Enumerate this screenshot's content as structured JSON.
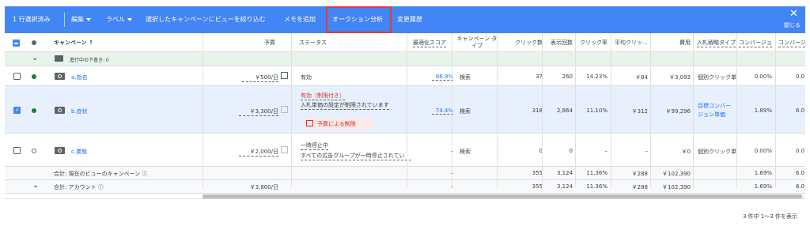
{
  "toolbar": {
    "selected": "1 行選択済み",
    "edit": "編集",
    "label": "ラベル",
    "filter_view": "選択したキャンペーンにビューを絞り込む",
    "add_memo": "メモを追加",
    "auction": "オークション分析",
    "history": "変更履歴",
    "close": "閉じる"
  },
  "colors": {
    "toolbar": "#4285f4",
    "link": "#1a73e8",
    "highlight": "#e53935",
    "selected_row": "#e8f0fe",
    "folder_row": "#e6f4ea",
    "status_red": "#d93025",
    "budget_limited_bg": "#fce8e6"
  },
  "header": {
    "campaign": "キャンペーン",
    "budget": "予算",
    "status": "ステータス",
    "opt_score": "最適化スコア",
    "type": "キャンペーン タイプ",
    "clicks": "クリック数",
    "impressions": "表示回数",
    "ctr": "クリック率",
    "avg_cpc": "平均クリッ…",
    "cost": "費用",
    "bid_strategy": "入札戦略タイプ",
    "conv1": "コンバージョ",
    "conv2": "コンバージョ"
  },
  "folder": {
    "label": "進行中の下書き: 0"
  },
  "rows": [
    {
      "name": "a.指名",
      "budget": "￥500/日",
      "status": "有効",
      "opt": "86.9%",
      "type": "検索",
      "clicks": "37",
      "impr": "260",
      "ctr": "14.23%",
      "cpc": "￥84",
      "cost": "￥3,093",
      "bid": "個別クリック単価",
      "conv1": "0.00%",
      "conv2": "0.0"
    },
    {
      "name": "b.症状",
      "budget": "￥3,300/日",
      "status": "有効（制限付き）",
      "status_sub": "入札単価の設定が制限されています",
      "status_badge": "予算による制限",
      "opt": "74.4%",
      "type": "検索",
      "clicks": "318",
      "impr": "2,864",
      "ctr": "11.10%",
      "cpc": "￥312",
      "cost": "￥99,296",
      "bid": "目標コンバージョン単価",
      "conv1": "1.89%",
      "conv2": "6.0"
    },
    {
      "name": "c.業態",
      "budget": "￥2,000/日",
      "status": "一時停止中",
      "status_sub": "すべての広告グループが一時停止されてい",
      "opt": "–",
      "type": "検索",
      "clicks": "0",
      "impr": "0",
      "ctr": "–",
      "cpc": "–",
      "cost": "￥0",
      "bid": "個別クリック単価",
      "conv1": "0.00%",
      "conv2": "0.0"
    }
  ],
  "totals": [
    {
      "label": "合計: 現在のビューのキャンペーン",
      "opt": "–",
      "clicks": "355",
      "impr": "3,124",
      "ctr": "11.36%",
      "cpc": "￥288",
      "cost": "￥102,390",
      "conv1": "1.69%",
      "conv2": "6.0"
    },
    {
      "label": "合計: アカウント",
      "budget": "￥3,800/日",
      "opt": "–",
      "clicks": "355",
      "impr": "3,124",
      "ctr": "11.36%",
      "cpc": "￥288",
      "cost": "￥102,390",
      "conv1": "1.69%",
      "conv2": "6.0"
    }
  ],
  "footer": {
    "pagination": "3 件中 1〜3 件を表示"
  }
}
